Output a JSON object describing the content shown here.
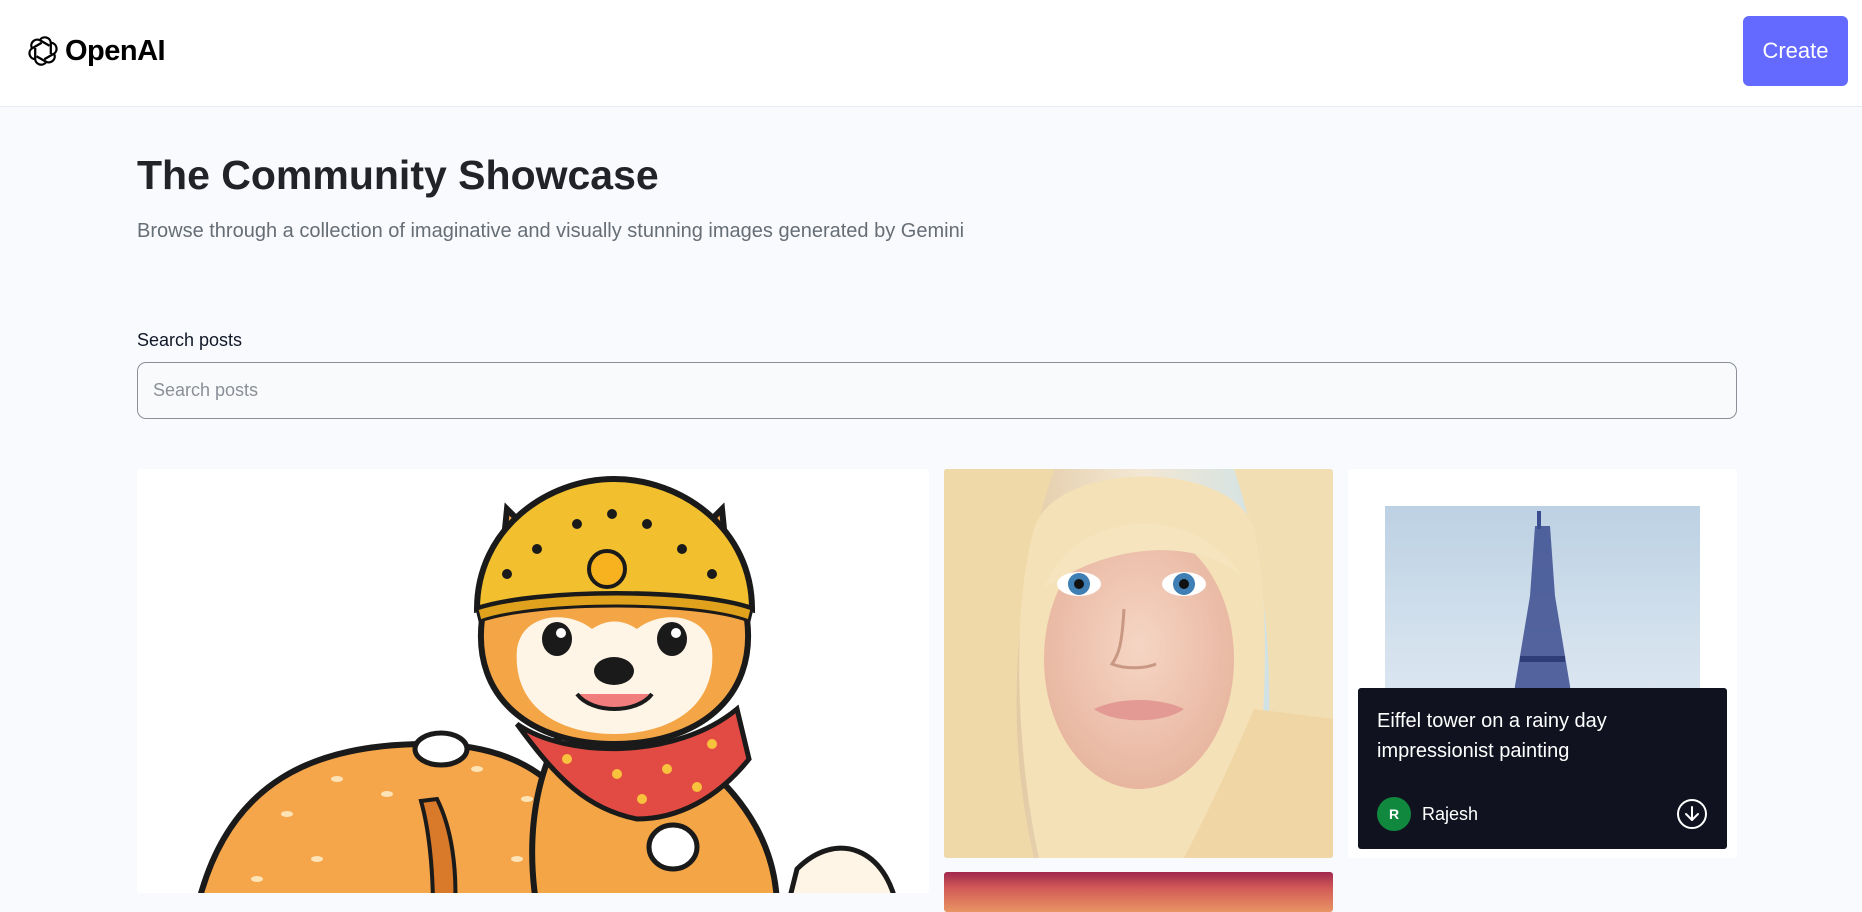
{
  "header": {
    "logo_text": "OpenAI",
    "create_label": "Create"
  },
  "main": {
    "title": "The Community Showcase",
    "subtitle": "Browse through a collection of imaginative and visually stunning images generated by Gemini",
    "search": {
      "label": "Search posts",
      "placeholder": "Search posts",
      "value": ""
    }
  },
  "posts": [
    {
      "image": "shiba-inu-cartoon-with-crown-and-scarf"
    },
    {
      "image": "blonde-woman-portrait"
    },
    {
      "image": "eiffel-tower-rainy-painting",
      "prompt": "Eiffel tower on a rainy day impressionist painting",
      "author": "Rajesh",
      "author_initial": "R"
    },
    {
      "image": "sunset-gradient"
    }
  ],
  "colors": {
    "accent": "#6469ff",
    "avatar": "#10893e",
    "overlay": "#10131f",
    "page_bg": "#f9fafe"
  },
  "icons": [
    "openai-logo-icon",
    "download-icon"
  ]
}
